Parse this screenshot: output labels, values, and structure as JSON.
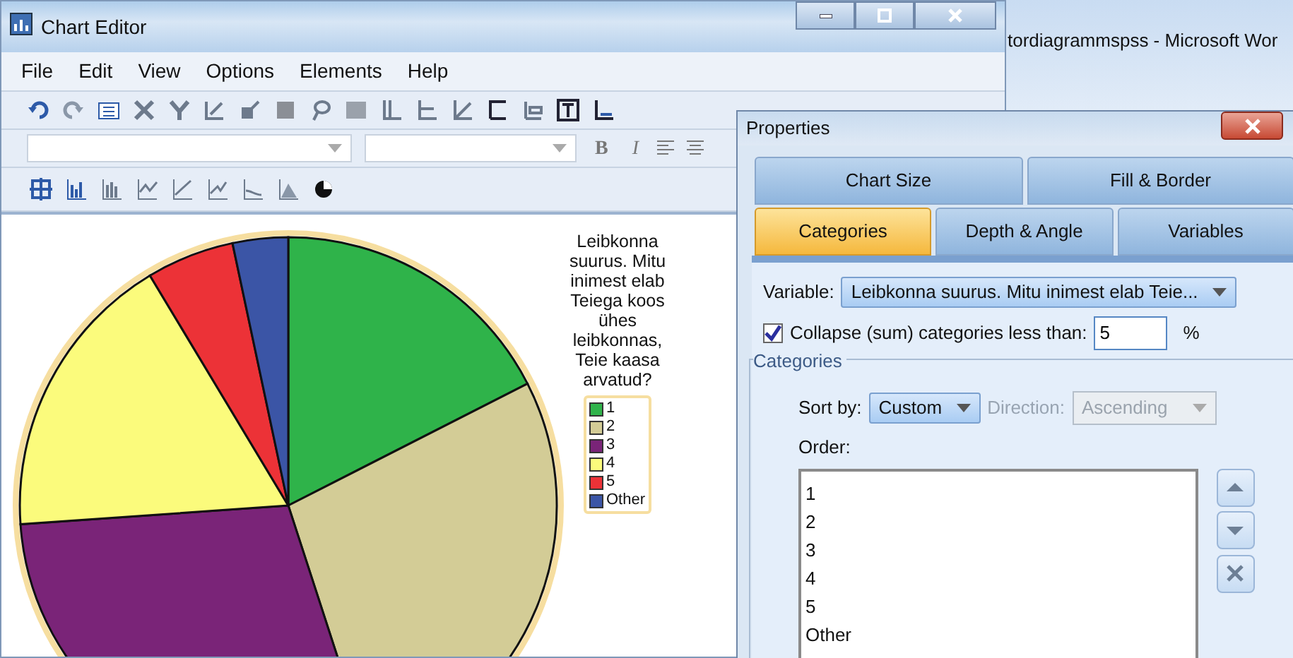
{
  "background_window": {
    "title": "tordiagrammspss - Microsoft Wor"
  },
  "chart_editor": {
    "title": "Chart Editor",
    "menu": [
      "File",
      "Edit",
      "View",
      "Options",
      "Elements",
      "Help"
    ],
    "format_buttons": [
      "B",
      "I"
    ],
    "chart": {
      "legend_title": "Leibkonna suurus. Mitu inimest elab Teiega koos ühes leibkonnas, Teie kaasa arvatud?",
      "legend": [
        {
          "label": "1",
          "color": "#2fb34a"
        },
        {
          "label": "2",
          "color": "#d3cc96"
        },
        {
          "label": "3",
          "color": "#7a2478"
        },
        {
          "label": "4",
          "color": "#fbfb7c"
        },
        {
          "label": "5",
          "color": "#ec3237"
        },
        {
          "label": "Other",
          "color": "#3b55a6"
        }
      ]
    }
  },
  "properties": {
    "title": "Properties",
    "tabs": [
      [
        {
          "label": "Chart Size",
          "selected": false
        },
        {
          "label": "Fill & Border",
          "selected": false
        }
      ],
      [
        {
          "label": "Categories",
          "selected": true
        },
        {
          "label": "Depth & Angle",
          "selected": false
        },
        {
          "label": "Variables",
          "selected": false
        }
      ]
    ],
    "variable": {
      "label": "Variable:",
      "value": "Leibkonna suurus. Mitu inimest elab Teie..."
    },
    "collapse": {
      "label": "Collapse (sum) categories less than:",
      "checked": true,
      "value": "5",
      "unit": "%"
    },
    "group_title": "Categories",
    "sort_by": {
      "label": "Sort by:",
      "value": "Custom"
    },
    "direction": {
      "label": "Direction:",
      "value": "Ascending",
      "disabled": true
    },
    "order_label": "Order:",
    "order": [
      "1",
      "2",
      "3",
      "4",
      "5",
      "Other"
    ]
  }
}
